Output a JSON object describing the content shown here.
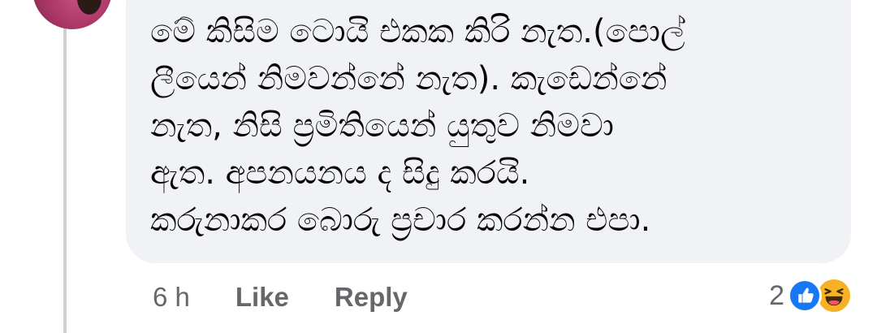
{
  "comment": {
    "lines": [
      "මේ කිසිම ටොයි එකක කිරි නැත.(පොල්",
      "ලීයෙන් නිමවන්නේ නැත). කැඩෙන්නේ",
      "නැත, නිසි ප්‍රමිතියෙන් යුතුව නිමවා",
      "ඇත. අපනයනය ද සිදු කරයි.",
      "කරුනාකර බොරු ප්‍රචාර කරන්න එපා."
    ]
  },
  "actions": {
    "time": "6 h",
    "like_label": "Like",
    "reply_label": "Reply"
  },
  "reactions": {
    "count": "2",
    "types": [
      "like-icon",
      "haha-icon"
    ],
    "like_color": "#1877f2",
    "haha_color": "#f7b125"
  },
  "colors": {
    "bubble": "#f0f2f5",
    "text": "#050505",
    "secondary_text": "#65676b",
    "thread_line": "#ced0d4"
  }
}
